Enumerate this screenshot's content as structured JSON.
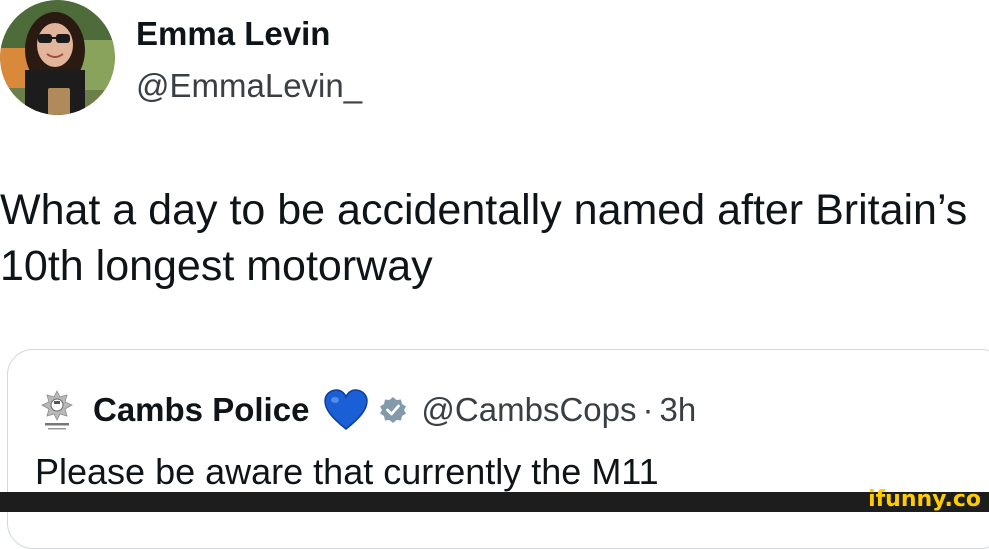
{
  "tweet": {
    "author": {
      "name": "Emma Levin",
      "handle": "@EmmaLevin_",
      "avatar_icon": "profile-photo"
    },
    "text_lines": [
      "What a day to be accidentally named after Britain’s",
      "10th longest motorway"
    ]
  },
  "quote": {
    "author": {
      "name": "Cambs Police",
      "handle": "@CambsCops",
      "logo_icon": "police-crest-icon"
    },
    "separator": "·",
    "time": "3h",
    "heart_icon": "blue-heart-icon",
    "verified_icon": "verified-badge-icon",
    "text": "Please be aware that currently the M11",
    "colors": {
      "heart": "#1a5fd6",
      "verified": "#829aab"
    }
  },
  "watermark": {
    "text": "ifunny.co",
    "color": "#ffcc00"
  }
}
